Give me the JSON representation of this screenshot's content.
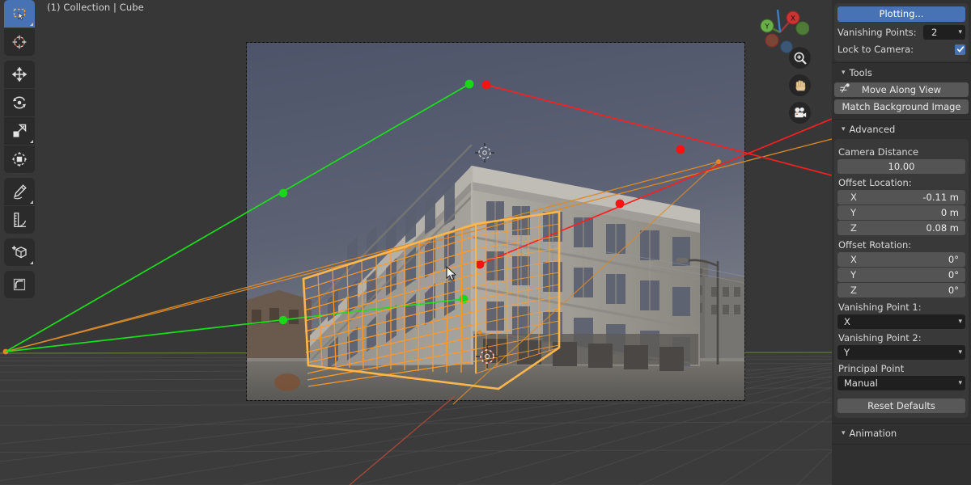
{
  "viewport": {
    "header_text": "(1) Collection | Cube",
    "toolbar": [
      {
        "group": 0,
        "name": "select-box-tool",
        "icon": "select-box-icon",
        "active": true
      },
      {
        "group": 0,
        "name": "cursor-tool",
        "icon": "cursor-3d-icon",
        "active": false
      },
      {
        "group": 1,
        "name": "move-tool",
        "icon": "move-icon",
        "active": false
      },
      {
        "group": 1,
        "name": "rotate-tool",
        "icon": "rotate-icon",
        "active": false
      },
      {
        "group": 1,
        "name": "scale-tool",
        "icon": "scale-icon",
        "active": false
      },
      {
        "group": 1,
        "name": "transform-tool",
        "icon": "transform-icon",
        "active": false
      },
      {
        "group": 2,
        "name": "annotate-tool",
        "icon": "pencil-icon",
        "active": false
      },
      {
        "group": 2,
        "name": "measure-tool",
        "icon": "ruler-icon",
        "active": false
      },
      {
        "group": 3,
        "name": "add-cube-tool",
        "icon": "add-cube-icon",
        "active": false
      },
      {
        "group": 4,
        "name": "bevel-tool",
        "icon": "bevel-icon",
        "active": false
      }
    ],
    "gizmo": {
      "axis_x_label": "X",
      "axis_y_label": "Y",
      "axis_z_label": "",
      "color_x": "#cc3333",
      "color_y": "#6ab04a",
      "color_z": "#3e7ebf"
    },
    "nav_buttons": [
      {
        "name": "zoom-button",
        "icon": "magnifier-icon"
      },
      {
        "name": "pan-button",
        "icon": "hand-icon"
      },
      {
        "name": "camera-view-button",
        "icon": "camera-icon"
      }
    ],
    "scene": {
      "object_name": "Cube",
      "wireframe_color": "#ff9a28",
      "vanishing_line_1_color": "#1ae01a",
      "vanishing_line_2_color": "#fa2020",
      "horizon_color": "#d98a2a",
      "grid_color": "#4d4d4d"
    }
  },
  "sidebar": {
    "plotting_button": "Plotting...",
    "vanishing_points_label": "Vanishing Points:",
    "vanishing_points_value": "2",
    "lock_to_camera_label": "Lock to Camera:",
    "lock_to_camera_checked": true,
    "tools_section": {
      "title": "Tools",
      "move_along_view": "Move Along View",
      "match_background_image": "Match Background Image"
    },
    "advanced_section": {
      "title": "Advanced",
      "camera_distance_label": "Camera Distance",
      "camera_distance_value": "10.00",
      "offset_location_label": "Offset Location:",
      "offset_location": [
        {
          "axis": "X",
          "value": "-0.11 m"
        },
        {
          "axis": "Y",
          "value": "0 m"
        },
        {
          "axis": "Z",
          "value": "0.08 m"
        }
      ],
      "offset_rotation_label": "Offset Rotation:",
      "offset_rotation": [
        {
          "axis": "X",
          "value": "0°"
        },
        {
          "axis": "Y",
          "value": "0°"
        },
        {
          "axis": "Z",
          "value": "0°"
        }
      ],
      "vanishing_point_1_label": "Vanishing Point 1:",
      "vanishing_point_1_value": "X",
      "vanishing_point_2_label": "Vanishing Point 2:",
      "vanishing_point_2_value": "Y",
      "principal_point_label": "Principal Point",
      "principal_point_value": "Manual",
      "reset_defaults": "Reset Defaults"
    },
    "animation_section": {
      "title": "Animation"
    }
  }
}
